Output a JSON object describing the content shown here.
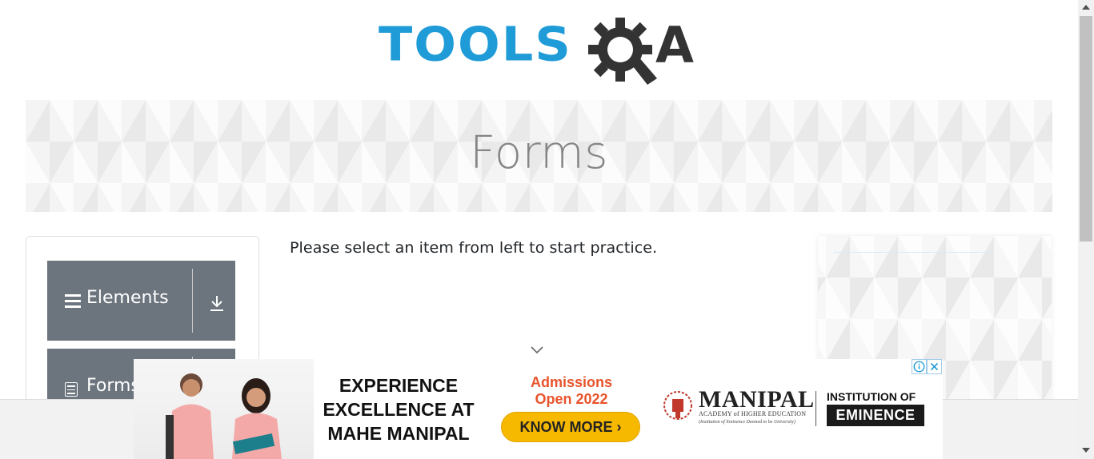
{
  "header": {
    "logo_text": "TOOLSQA",
    "logo_tools": "TOOLS",
    "logo_a": "A",
    "logo_icon": "gear-magnifier-icon"
  },
  "banner": {
    "title": "Forms"
  },
  "sidebar": {
    "groups": [
      {
        "label": "Elements",
        "icon": "hamburger-icon",
        "action_icon": "download-icon"
      },
      {
        "label": "Forms",
        "icon": "document-icon"
      }
    ]
  },
  "main": {
    "prompt": "Please select an item from left to start practice.",
    "scroll_hint_icon": "chevron-down-icon"
  },
  "ad": {
    "headline": "EXPERIENCE EXCELLENCE AT MAHE MANIPAL",
    "admissions": "Admissions Open 2022",
    "cta": "KNOW MORE ›",
    "brand_name": "MANIPAL",
    "brand_sub": "ACADEMY of HIGHER EDUCATION",
    "brand_tagline": "(Institution of Eminence Deemed to be University)",
    "institution_of": "INSTITUTION OF",
    "eminence": "EMINENCE",
    "info_icon": "info-icon",
    "close_icon": "close-icon"
  },
  "colors": {
    "brand_blue": "#1f9bd7",
    "sidebar_bg": "#6c757d",
    "cta_yellow": "#f7b800",
    "admissions_orange": "#e8542b"
  }
}
